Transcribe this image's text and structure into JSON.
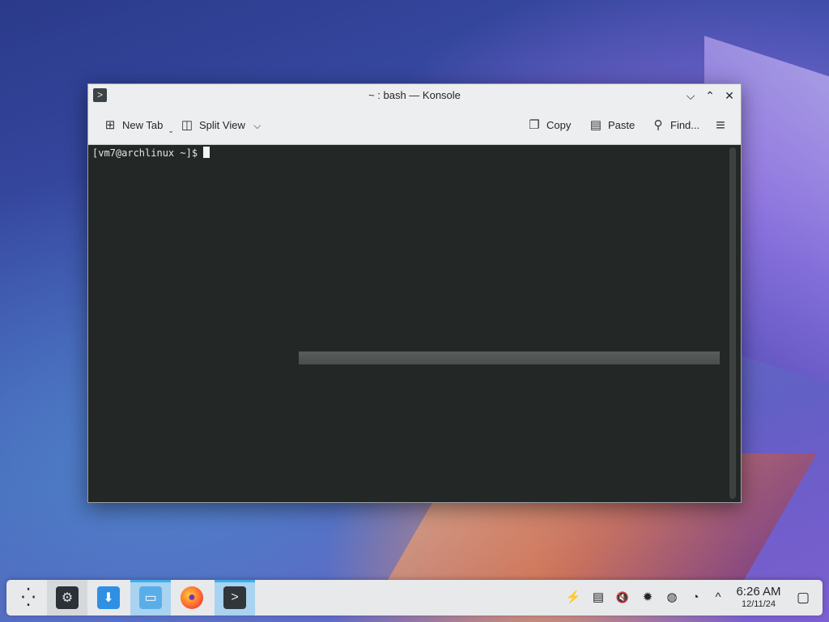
{
  "window": {
    "title": "~ : bash — Konsole",
    "app_icon": ">",
    "buttons": {
      "minimize": "⌵",
      "maximize": "⌃",
      "close": "✕"
    }
  },
  "toolbar": {
    "new_tab": "New Tab",
    "split_view": "Split View",
    "copy": "Copy",
    "paste": "Paste",
    "find": "Find...",
    "icons": {
      "new_tab": "⊞",
      "split_view": "◫",
      "split_caret": "⌵",
      "copy": "❐",
      "paste": "▤",
      "find": "⚲",
      "menu": "≡",
      "tab_caret": "⌄"
    }
  },
  "terminal": {
    "prompt": "[vm7@archlinux ~]$"
  },
  "taskbar": {
    "launcher_icon": "⁛",
    "apps": [
      {
        "name": "system-settings",
        "glyph": "⚙"
      },
      {
        "name": "discover",
        "glyph": "⬇"
      },
      {
        "name": "dolphin",
        "glyph": "▭"
      },
      {
        "name": "firefox",
        "glyph": "●"
      },
      {
        "name": "konsole",
        "glyph": ">"
      }
    ],
    "tray_icons": {
      "network": "⚡",
      "clipboard": "▤",
      "volume": "🔇",
      "brightness": "✹",
      "globe": "◍",
      "updates": "◔",
      "expand": "^",
      "show_desktop": "▢"
    },
    "clock": {
      "time": "6:26 AM",
      "date": "12/11/24"
    }
  }
}
